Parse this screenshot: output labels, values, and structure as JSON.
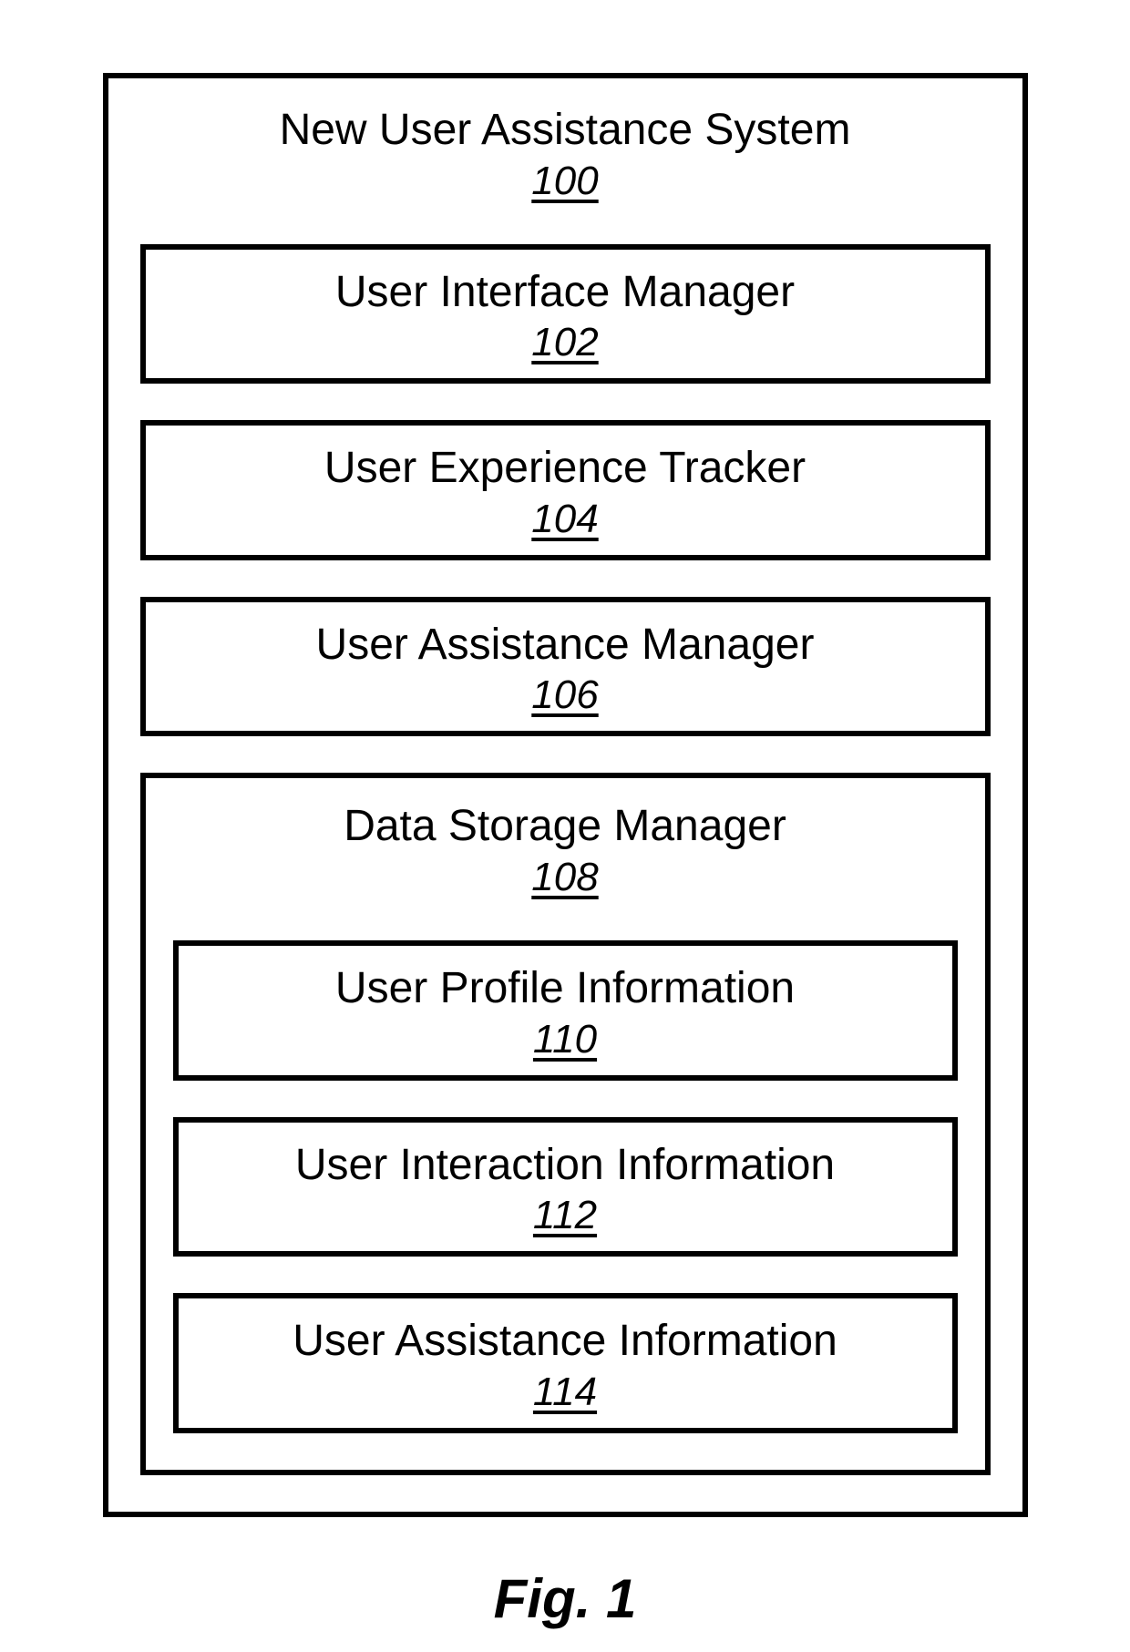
{
  "system": {
    "title": "New User Assistance System",
    "refnum": "100",
    "modules": [
      {
        "title": "User Interface Manager",
        "refnum": "102"
      },
      {
        "title": "User Experience Tracker",
        "refnum": "104"
      },
      {
        "title": "User Assistance Manager",
        "refnum": "106"
      }
    ],
    "data_storage": {
      "title": "Data Storage Manager",
      "refnum": "108",
      "items": [
        {
          "title": "User Profile Information",
          "refnum": "110"
        },
        {
          "title": "User Interaction Information",
          "refnum": "112"
        },
        {
          "title": "User Assistance Information",
          "refnum": "114"
        }
      ]
    }
  },
  "figure_caption": "Fig. 1"
}
